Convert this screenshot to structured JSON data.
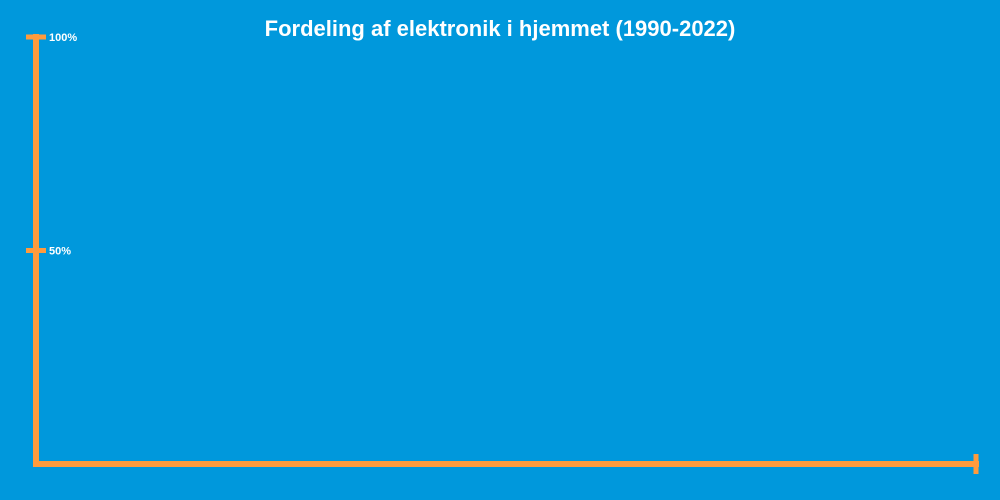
{
  "chart_data": {
    "type": "area",
    "title": "Fordeling af elektronik i hjemmet (1990-2022)",
    "xlabel": "",
    "ylabel": "",
    "ylim": [
      0,
      100
    ],
    "y_ticks": [
      {
        "value": 50,
        "label": "50%"
      },
      {
        "value": 100,
        "label": "100%"
      }
    ],
    "series": [],
    "grid": false,
    "colors": {
      "background": "#0098dc",
      "axis": "#ff9b3d",
      "text": "#ffffff"
    }
  }
}
